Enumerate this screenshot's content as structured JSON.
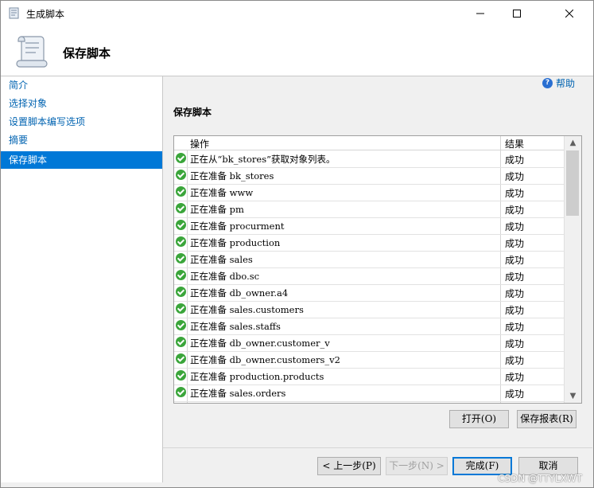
{
  "window": {
    "title": "生成脚本"
  },
  "header": {
    "title": "保存脚本"
  },
  "sidebar": {
    "items": [
      {
        "label": "简介"
      },
      {
        "label": "选择对象"
      },
      {
        "label": "设置脚本编写选项"
      },
      {
        "label": "摘要"
      },
      {
        "label": "保存脚本",
        "active": true
      }
    ]
  },
  "main": {
    "help_label": "帮助",
    "section_title": "保存脚本",
    "grid": {
      "columns": [
        "操作",
        "结果"
      ],
      "rows": [
        {
          "op": "正在从“bk_stores”获取对象列表。",
          "result": "成功"
        },
        {
          "op": "正在准备 bk_stores",
          "result": "成功"
        },
        {
          "op": "正在准备 www",
          "result": "成功"
        },
        {
          "op": "正在准备 pm",
          "result": "成功"
        },
        {
          "op": "正在准备 procurment",
          "result": "成功"
        },
        {
          "op": "正在准备 production",
          "result": "成功"
        },
        {
          "op": "正在准备 sales",
          "result": "成功"
        },
        {
          "op": "正在准备 dbo.sc",
          "result": "成功"
        },
        {
          "op": "正在准备 db_owner.a4",
          "result": "成功"
        },
        {
          "op": "正在准备 sales.customers",
          "result": "成功"
        },
        {
          "op": "正在准备 sales.staffs",
          "result": "成功"
        },
        {
          "op": "正在准备 db_owner.customer_v",
          "result": "成功"
        },
        {
          "op": "正在准备 db_owner.customers_v2",
          "result": "成功"
        },
        {
          "op": "正在准备 production.products",
          "result": "成功"
        },
        {
          "op": "正在准备 sales.orders",
          "result": "成功"
        }
      ]
    },
    "buttons": {
      "open": "打开(O)",
      "save_report": "保存报表(R)",
      "prev": "< 上一步(P)",
      "next": "下一步(N) >",
      "finish": "完成(F)",
      "cancel": "取消"
    }
  },
  "watermark": "CSDN @TTYLXWT",
  "colors": {
    "accent": "#0078d7",
    "link": "#0063b1",
    "success": "#3aa53a"
  }
}
